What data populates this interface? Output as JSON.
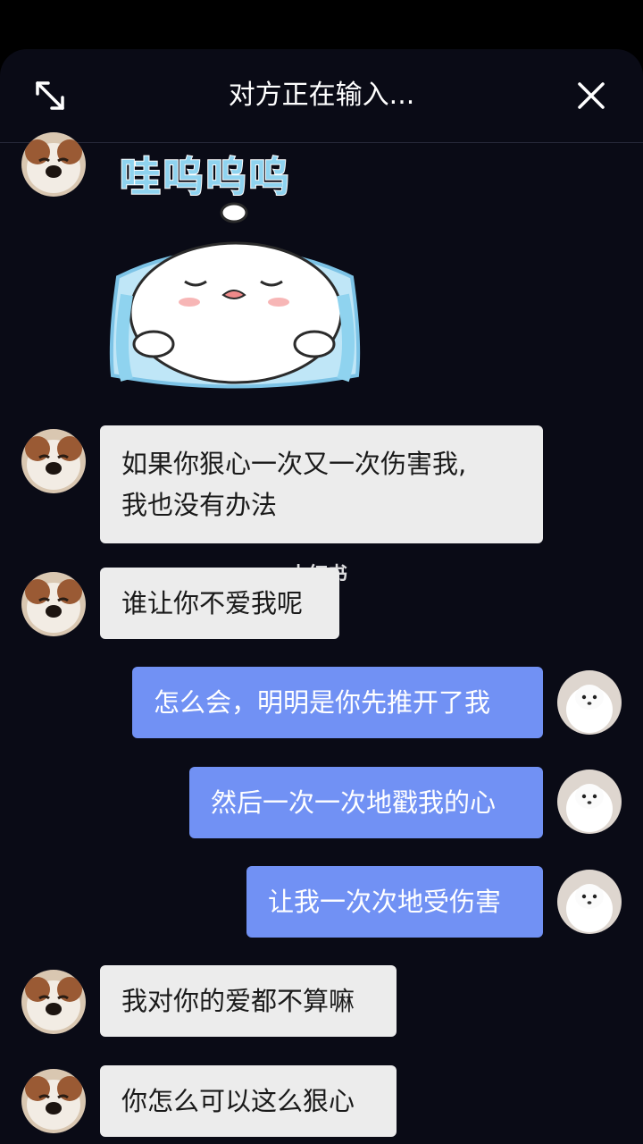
{
  "header": {
    "title": "对方正在输入...",
    "expand_icon": "expand-diagonal-icon",
    "close_icon": "close-icon"
  },
  "sticker": {
    "text": "哇呜呜呜",
    "description_icon": "crying-bun-sticker"
  },
  "watermark": "小红书",
  "colors": {
    "background": "#0a0b16",
    "incoming_bubble": "#ececec",
    "outgoing_bubble": "#7191f4"
  },
  "messages": [
    {
      "side": "in",
      "lines": [
        "如果你狠心一次又一次伤害我,",
        "我也没有办法"
      ]
    },
    {
      "side": "in",
      "lines": [
        "谁让你不爱我呢"
      ]
    },
    {
      "side": "out",
      "lines": [
        "怎么会，明明是你先推开了我"
      ]
    },
    {
      "side": "out",
      "lines": [
        "然后一次一次地戳我的心"
      ]
    },
    {
      "side": "out",
      "lines": [
        "让我一次次地受伤害"
      ]
    },
    {
      "side": "in",
      "lines": [
        "我对你的爱都不算嘛"
      ]
    },
    {
      "side": "in",
      "lines": [
        "你怎么可以这么狠心"
      ]
    }
  ]
}
